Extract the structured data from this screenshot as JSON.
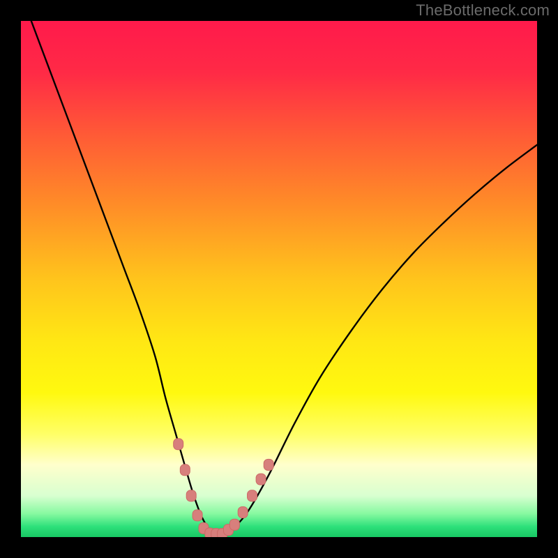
{
  "watermark": "TheBottleneck.com",
  "colors": {
    "frame": "#000000",
    "curve": "#000000",
    "marker_fill": "#d77f7c",
    "marker_stroke": "#cc6a66",
    "gradient_stops": [
      {
        "offset": 0.0,
        "color": "#ff1a4b"
      },
      {
        "offset": 0.1,
        "color": "#ff2a46"
      },
      {
        "offset": 0.22,
        "color": "#ff5a36"
      },
      {
        "offset": 0.35,
        "color": "#ff8a28"
      },
      {
        "offset": 0.5,
        "color": "#ffc41c"
      },
      {
        "offset": 0.62,
        "color": "#ffe714"
      },
      {
        "offset": 0.72,
        "color": "#fff90f"
      },
      {
        "offset": 0.8,
        "color": "#ffff66"
      },
      {
        "offset": 0.86,
        "color": "#ffffcc"
      },
      {
        "offset": 0.92,
        "color": "#d8ffd0"
      },
      {
        "offset": 0.955,
        "color": "#86f9a0"
      },
      {
        "offset": 0.98,
        "color": "#2de07a"
      },
      {
        "offset": 1.0,
        "color": "#18c864"
      }
    ]
  },
  "chart_data": {
    "type": "line",
    "title": "",
    "xlabel": "",
    "ylabel": "",
    "xlim": [
      0,
      100
    ],
    "ylim": [
      0,
      100
    ],
    "series": [
      {
        "name": "bottleneck-curve",
        "x": [
          2,
          5,
          8,
          11,
          14,
          17,
          20,
          23,
          26,
          28,
          30,
          32,
          33.5,
          35,
          36.5,
          38,
          39.5,
          41,
          44,
          48,
          53,
          58,
          64,
          70,
          76,
          82,
          88,
          94,
          100
        ],
        "y": [
          100,
          92,
          84,
          76,
          68,
          60,
          52,
          44,
          35,
          27,
          20,
          13,
          8,
          4,
          1.5,
          0.6,
          0.6,
          1.5,
          5,
          12,
          22,
          31,
          40,
          48,
          55,
          61,
          66.5,
          71.5,
          76
        ]
      }
    ],
    "markers": {
      "name": "highlight-points",
      "points": [
        {
          "x": 30.5,
          "y": 18
        },
        {
          "x": 31.8,
          "y": 13
        },
        {
          "x": 33.0,
          "y": 8
        },
        {
          "x": 34.2,
          "y": 4.2
        },
        {
          "x": 35.4,
          "y": 1.7
        },
        {
          "x": 36.6,
          "y": 0.7
        },
        {
          "x": 37.8,
          "y": 0.6
        },
        {
          "x": 39.0,
          "y": 0.6
        },
        {
          "x": 40.2,
          "y": 1.4
        },
        {
          "x": 41.4,
          "y": 2.4
        },
        {
          "x": 43.0,
          "y": 4.8
        },
        {
          "x": 44.8,
          "y": 8.0
        },
        {
          "x": 46.5,
          "y": 11.2
        },
        {
          "x": 48.0,
          "y": 14.0
        }
      ]
    }
  }
}
